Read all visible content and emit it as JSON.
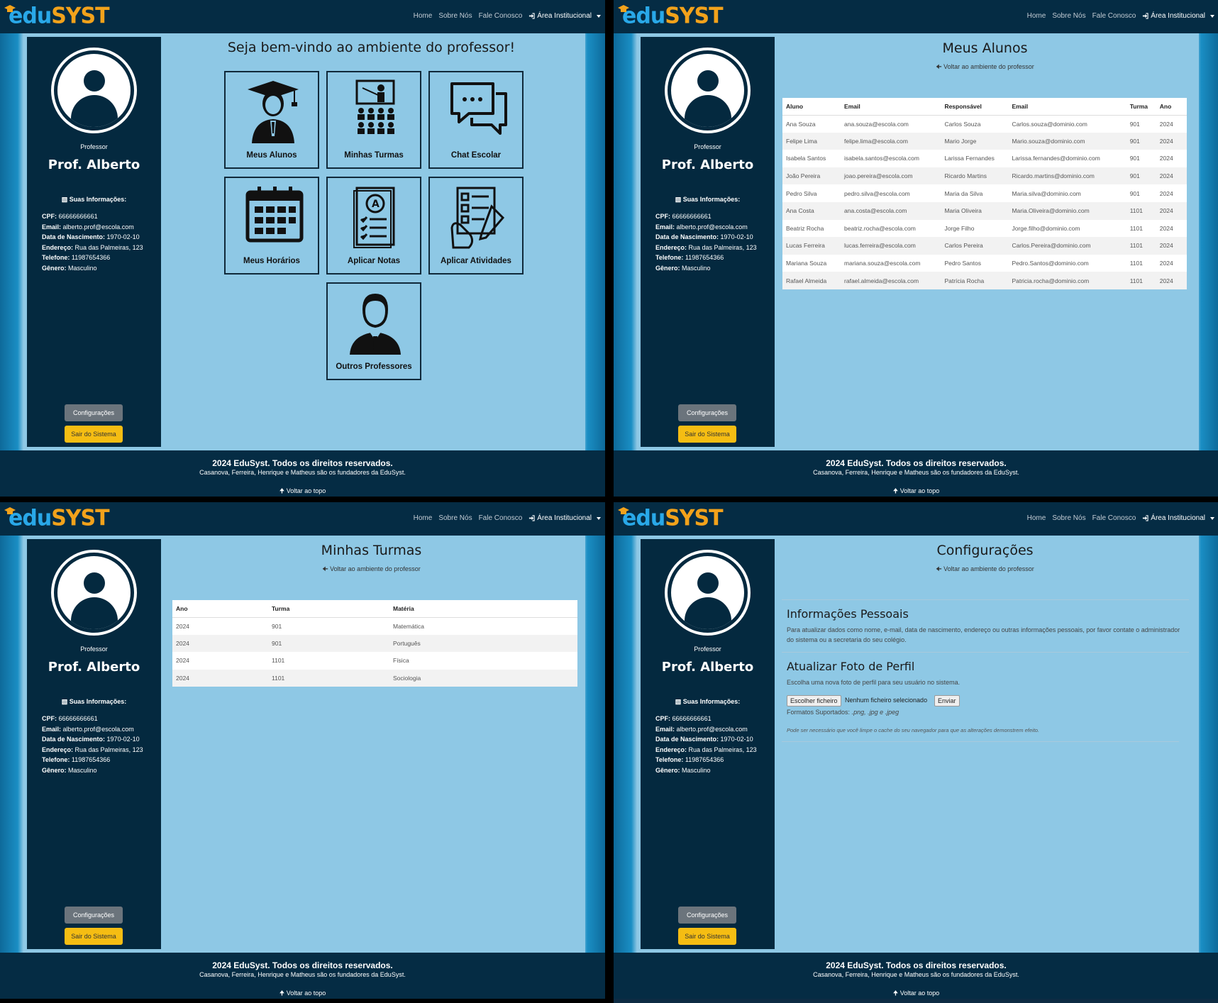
{
  "brand": {
    "edu": "edu",
    "syst": "SYST"
  },
  "nav": {
    "home": "Home",
    "about": "Sobre Nós",
    "contact": "Fale Conosco",
    "institutional": "Área Institucional"
  },
  "sidebar": {
    "role": "Professor",
    "name": "Prof. Alberto",
    "info_title": "Suas Informações:",
    "info": [
      {
        "label": "CPF:",
        "value": "66666666661"
      },
      {
        "label": "Email:",
        "value": "alberto.prof@escola.com"
      },
      {
        "label": "Data de Nascimento:",
        "value": "1970-02-10"
      },
      {
        "label": "Endereço:",
        "value": "Rua das Palmeiras, 123"
      },
      {
        "label": "Telefone:",
        "value": "11987654366"
      },
      {
        "label": "Gênero:",
        "value": "Masculino"
      }
    ],
    "config_button": "Configurações",
    "exit_button": "Sair do Sistema"
  },
  "footer": {
    "rights": "2024 EduSyst. Todos os direitos reservados.",
    "founders": "Casanova, Ferreira, Henrique e Matheus são os fundadores da EduSyst.",
    "back_top": "Voltar ao topo"
  },
  "back_link": "Voltar ao ambiente do professor",
  "home": {
    "title": "Seja bem-vindo ao ambiente do professor!",
    "tiles": [
      {
        "label": "Meus Alunos",
        "icon": "graduate-icon"
      },
      {
        "label": "Minhas Turmas",
        "icon": "classroom-icon"
      },
      {
        "label": "Chat Escolar",
        "icon": "chat-icon"
      },
      {
        "label": "Meus Horários",
        "icon": "calendar-icon"
      },
      {
        "label": "Aplicar Notas",
        "icon": "grade-sheet-icon"
      },
      {
        "label": "Aplicar Atividades",
        "icon": "activity-icon"
      },
      {
        "label": "Outros Professores",
        "icon": "teacher-icon"
      }
    ]
  },
  "students": {
    "title": "Meus Alunos",
    "headers": [
      "Aluno",
      "Email",
      "Responsável",
      "Email",
      "Turma",
      "Ano"
    ],
    "rows": [
      [
        "Ana Souza",
        "ana.souza@escola.com",
        "Carlos Souza",
        "Carlos.souza@dominio.com",
        "901",
        "2024"
      ],
      [
        "Felipe Lima",
        "felipe.lima@escola.com",
        "Mario Jorge",
        "Mario.souza@dominio.com",
        "901",
        "2024"
      ],
      [
        "Isabela Santos",
        "isabela.santos@escola.com",
        "Larissa Fernandes",
        "Larissa.fernandes@dominio.com",
        "901",
        "2024"
      ],
      [
        "João Pereira",
        "joao.pereira@escola.com",
        "Ricardo Martins",
        "Ricardo.martins@dominio.com",
        "901",
        "2024"
      ],
      [
        "Pedro Silva",
        "pedro.silva@escola.com",
        "Maria da Silva",
        "Maria.silva@dominio.com",
        "901",
        "2024"
      ],
      [
        "Ana Costa",
        "ana.costa@escola.com",
        "Maria Oliveira",
        "Maria.Oliveira@dominio.com",
        "1101",
        "2024"
      ],
      [
        "Beatriz Rocha",
        "beatriz.rocha@escola.com",
        "Jorge Filho",
        "Jorge.filho@dominio.com",
        "1101",
        "2024"
      ],
      [
        "Lucas Ferreira",
        "lucas.ferreira@escola.com",
        "Carlos Pereira",
        "Carlos.Pereira@dominio.com",
        "1101",
        "2024"
      ],
      [
        "Mariana Souza",
        "mariana.souza@escola.com",
        "Pedro Santos",
        "Pedro.Santos@dominio.com",
        "1101",
        "2024"
      ],
      [
        "Rafael Almeida",
        "rafael.almeida@escola.com",
        "Patrícia Rocha",
        "Patricia.rocha@dominio.com",
        "1101",
        "2024"
      ]
    ]
  },
  "classes": {
    "title": "Minhas Turmas",
    "headers": [
      "Ano",
      "Turma",
      "Matéria"
    ],
    "rows": [
      [
        "2024",
        "901",
        "Matemática"
      ],
      [
        "2024",
        "901",
        "Português"
      ],
      [
        "2024",
        "1101",
        "Física"
      ],
      [
        "2024",
        "1101",
        "Sociologia"
      ]
    ]
  },
  "settings": {
    "title": "Configurações",
    "personal_title": "Informações Pessoais",
    "personal_text": "Para atualizar dados como nome, e-mail, data de nascimento, endereço ou outras informações pessoais, por favor contate o administrador do sistema ou a secretaria do seu colégio.",
    "photo_title": "Atualizar Foto de Perfil",
    "photo_text": "Escolha uma nova foto de perfil para seu usuário no sistema.",
    "choose_file": "Escolher ficheiro",
    "no_file": "Nenhum ficheiro selecionado",
    "send": "Enviar",
    "formats_label": "Formatos Suportados:",
    "formats": ".png, .jpg e .jpeg",
    "cache_note": "Pode ser necessário que você limpe o cache do seu navegador para que as alterações demonstrem efeito."
  }
}
